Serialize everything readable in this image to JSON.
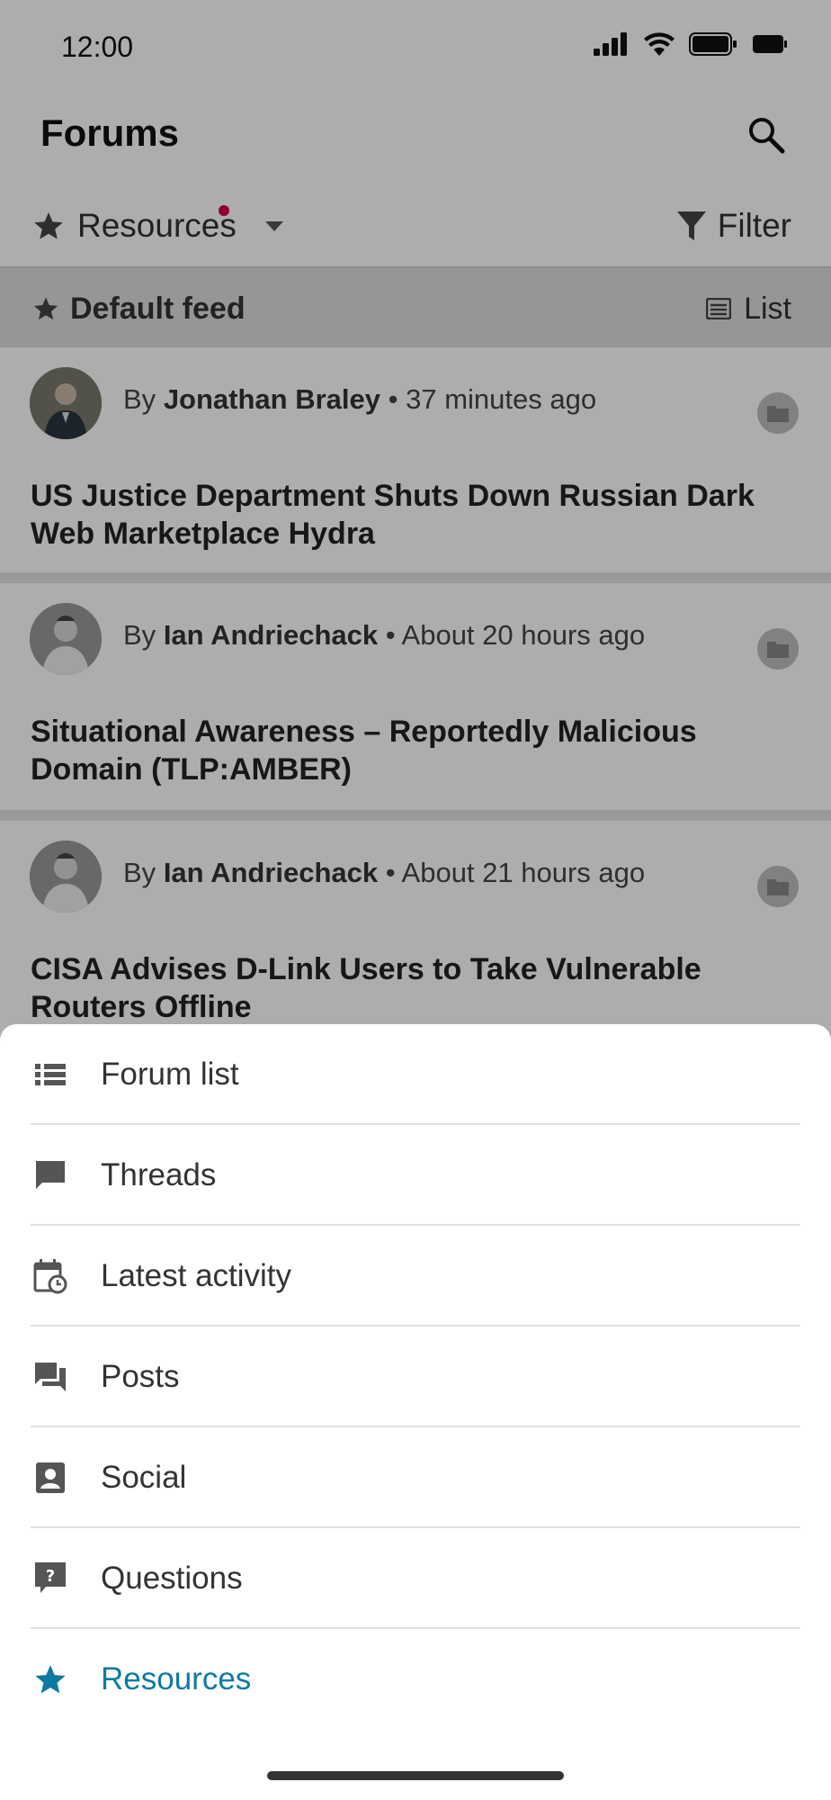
{
  "status_bar": {
    "time": "12:00"
  },
  "header": {
    "title": "Forums"
  },
  "toolbar": {
    "resources_label": "Resources",
    "filter_label": "Filter"
  },
  "feed_bar": {
    "title": "Default feed",
    "view_label": "List"
  },
  "threads": [
    {
      "by": "By",
      "author": "Jonathan Braley",
      "time": "37 minutes ago",
      "title": "US Justice Department Shuts Down Russian Dark Web Marketplace Hydra"
    },
    {
      "by": "By",
      "author": "Ian Andriechack",
      "time": "About 20 hours ago",
      "title": "Situational Awareness – Reportedly Malicious Domain (TLP:AMBER)"
    },
    {
      "by": "By",
      "author": "Ian Andriechack",
      "time": "About 21 hours ago",
      "title": "CISA Advises D-Link Users to Take Vulnerable Routers Offline"
    }
  ],
  "menu": {
    "items": [
      {
        "label": "Forum list",
        "icon": "list-icon"
      },
      {
        "label": "Threads",
        "icon": "chat-bubble-icon"
      },
      {
        "label": "Latest activity",
        "icon": "calendar-clock-icon"
      },
      {
        "label": "Posts",
        "icon": "forum-icon"
      },
      {
        "label": "Social",
        "icon": "contact-card-icon"
      },
      {
        "label": "Questions",
        "icon": "question-bubble-icon"
      },
      {
        "label": "Resources",
        "icon": "star-icon",
        "active": true
      }
    ]
  },
  "colors": {
    "accent": "#0f7aa1",
    "notification_dot": "#d1004c",
    "overlay": "rgba(0,0,0,0.32)"
  }
}
